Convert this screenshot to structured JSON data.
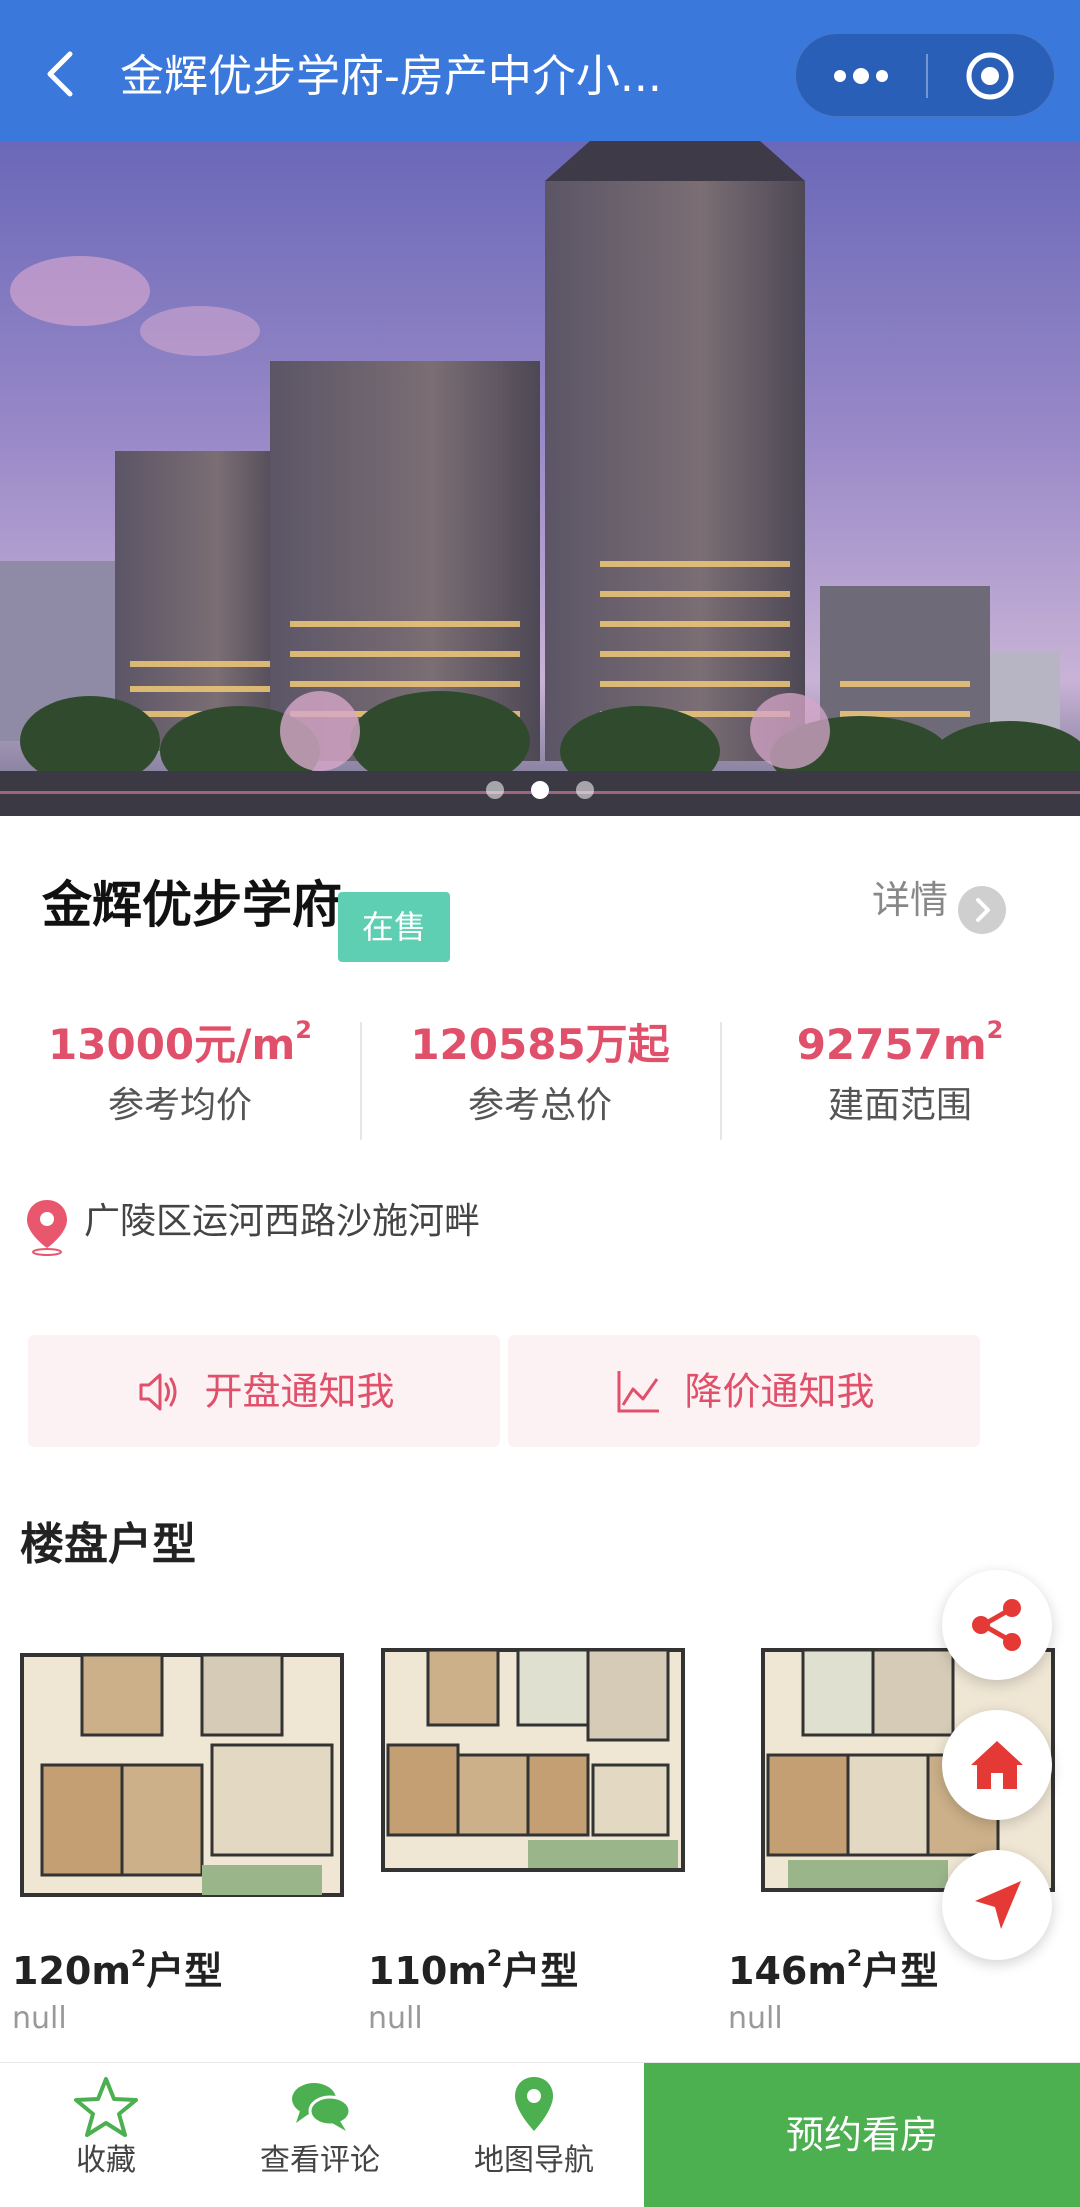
{
  "header": {
    "title": "金辉优步学府-房产中介小...",
    "back_icon": "chevron-left-icon",
    "more_icon": "more-dots-icon",
    "close_icon": "target-circle-icon",
    "background": "#3a78dc"
  },
  "banner": {
    "slides_count": 3,
    "active_slide": 2
  },
  "project": {
    "name": "金辉优步学府",
    "status": "在售",
    "detail_label": "详情"
  },
  "stats": [
    {
      "value": "13000元/m",
      "superscript": "2",
      "label": "参考均价"
    },
    {
      "value": "120585万起",
      "superscript": "",
      "label": "参考总价"
    },
    {
      "value": "92757m",
      "superscript": "2",
      "label": "建面范围"
    }
  ],
  "address": {
    "text": "广陵区运河西路沙施河畔",
    "icon": "location-pin-icon"
  },
  "notify": {
    "opening_label": "开盘通知我",
    "opening_icon": "speaker-icon",
    "price_drop_label": "降价通知我",
    "price_drop_icon": "trend-chart-icon"
  },
  "floorplans_section": {
    "title": "楼盘户型",
    "items": [
      {
        "area": "120m",
        "sup": "2",
        "suffix": "户型",
        "sub": "null"
      },
      {
        "area": "110m",
        "sup": "2",
        "suffix": "户型",
        "sub": "null"
      },
      {
        "area": "146m",
        "sup": "2",
        "suffix": "户型",
        "sub": "null"
      }
    ]
  },
  "fabs": [
    "share-icon",
    "home-icon",
    "navigate-arrow-icon"
  ],
  "bottom_bar": {
    "tabs": [
      {
        "label": "收藏",
        "icon": "star-icon"
      },
      {
        "label": "查看评论",
        "icon": "chat-bubbles-icon"
      },
      {
        "label": "地图导航",
        "icon": "map-pin-icon"
      }
    ],
    "reserve_label": "预约看房",
    "accent": "#4caf50"
  },
  "colors": {
    "price": "#e0506a",
    "badge": "#5ecfb3",
    "notify_bg": "#fdf2f3",
    "fab_icon": "#e53935"
  }
}
